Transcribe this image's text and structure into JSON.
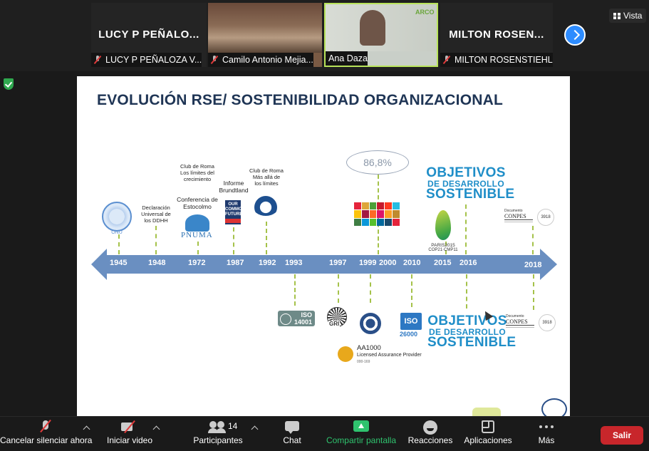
{
  "participants": [
    {
      "display_name": "LUCY P PEÑALO...",
      "label": "LUCY P PEÑALOZA V..."
    },
    {
      "label": "Camilo Antonio Mejia..."
    },
    {
      "label": "Ana Daza",
      "badge": "ARCO"
    },
    {
      "display_name": "MILTON  ROSEN...",
      "label": "MILTON ROSENSTIEHL"
    }
  ],
  "view_button": "Vista",
  "slide": {
    "title": "EVOLUCIÓN RSE/ SOSTENIBILIDAD ORGANIZACIONAL",
    "years": [
      "1945",
      "1948",
      "1972",
      "1987",
      "1992",
      "1993",
      "1997",
      "1999",
      "2000",
      "2010",
      "2015",
      "2016",
      "2018"
    ],
    "notes": {
      "onu": "ONU",
      "ddhh": "Declaración Universal de los DDHH",
      "club_roma": "Club de Roma Los límites del crecimiento",
      "estocolmo": "Conferencia de Estocolmo",
      "pnuma": "PNUMA",
      "brundtland": "Informe Brundtland",
      "ocf": [
        "OUR",
        "COMMON",
        "FUTURE"
      ],
      "club_roma_2": "Club de Roma Más allá de los límites",
      "percent": "86,8%",
      "ods_line1": "OBJETIVOS",
      "ods_line2": "DE DESARROLLO",
      "ods_line3": "SOSTENIBLE",
      "paris": "PARIS2015",
      "paris_sub": "COP21·CMP11",
      "conpes_caption": "Documento",
      "conpes_name": "CONPES",
      "conpes_number": "3918",
      "iso_top": "ISO",
      "iso_bottom": "14001",
      "gri": "GRI",
      "iso_2": "ISO",
      "iso_2_num": "26000",
      "aa_title": "AA1000",
      "aa_sub": "Licensed Assurance Provider",
      "aa_code": "000-169"
    }
  },
  "toolbar": {
    "mute": "Cancelar silenciar ahora",
    "video": "Iniciar video",
    "participants": "Participantes",
    "participants_count": "14",
    "chat": "Chat",
    "share": "Compartir pantalla",
    "reactions": "Reacciones",
    "apps": "Aplicaciones",
    "more": "Más",
    "leave": "Salir"
  },
  "colors": {
    "accent": "#2d8cff",
    "leave": "#c8262b",
    "share": "#2fc36e",
    "timeline": "#6a8fc1",
    "ods_blue": "#1f8ec8"
  }
}
